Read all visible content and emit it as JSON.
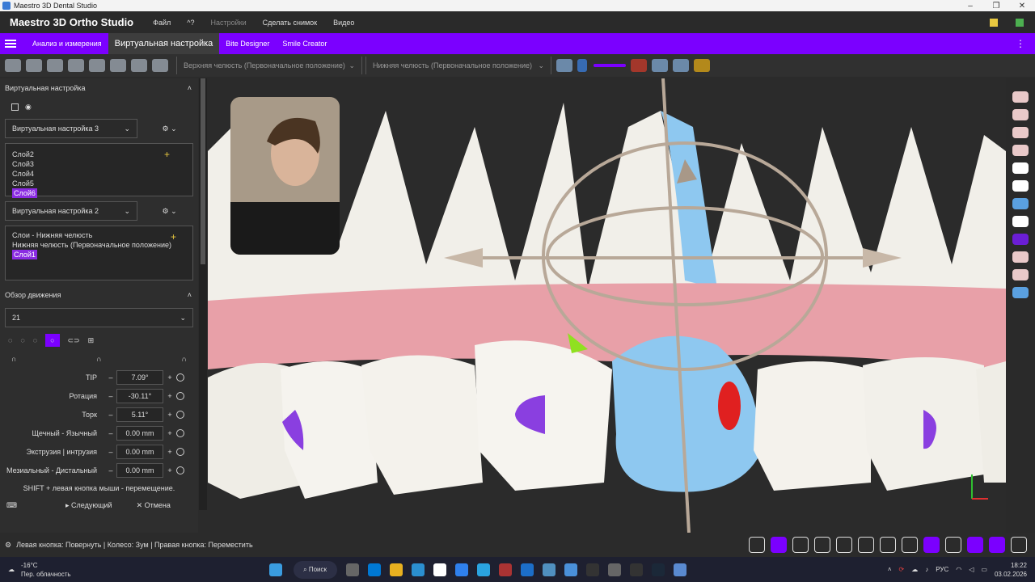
{
  "window": {
    "title": "Maestro 3D Dental Studio",
    "controls": [
      "–",
      "❐",
      "✕"
    ]
  },
  "menu": {
    "brand": "Maestro 3D Ortho Studio",
    "items": [
      "Файл",
      "^?",
      "Настройки",
      "Сделать снимок",
      "Видео"
    ]
  },
  "tabs": [
    "Анализ и измерения",
    "Виртуальная настройка",
    "Bite Designer",
    "Smile Creator"
  ],
  "toolbar": {
    "upper_jaw": "Верхняя челюсть (Первоначальное положение)",
    "lower_jaw": "Нижняя челюсть (Первоначальное положение)"
  },
  "panel": {
    "title": "Виртуальная настройка",
    "setup3": "Виртуальная настройка 3",
    "layers": [
      "Слой2",
      "Слой3",
      "Слой4",
      "Слой5",
      "Слой6"
    ],
    "setup2": "Виртуальная настройка 2",
    "lower_tree_title": "Слои - Нижняя челюсть",
    "lower_tree_item": "Нижняя челюсть (Первоначальное положение)",
    "lower_layer": "Слой1",
    "motion_title": "Обзор движения",
    "tooth_select": "21",
    "params": [
      {
        "label": "TIP",
        "value": "7.09°"
      },
      {
        "label": "Ротация",
        "value": "-30.11°"
      },
      {
        "label": "Торк",
        "value": "5.11°"
      },
      {
        "label": "Щечный - Язычный",
        "value": "0.00 mm"
      },
      {
        "label": "Экструзия | интрузия",
        "value": "0.00 mm"
      },
      {
        "label": "Мезиальный - Дистальный",
        "value": "0.00 mm"
      }
    ],
    "hint": "SHIFT + левая кнопка мыши - перемещение.",
    "next": "Следующий",
    "cancel": "Отмена"
  },
  "status": {
    "text": "Левая кнопка: Повернуть | Колесо: Зум | Правая кнопка: Переместить"
  },
  "taskbar": {
    "weather_temp": "-16°C",
    "weather_desc": "Пер. облачность",
    "search": "Поиск",
    "lang": "РУС",
    "time": "18:22",
    "date": "03.02.2026"
  },
  "colors": {
    "accent": "#7b00ff",
    "tooth_blue": "#8ec8f0",
    "gum": "#e8a0a8"
  }
}
